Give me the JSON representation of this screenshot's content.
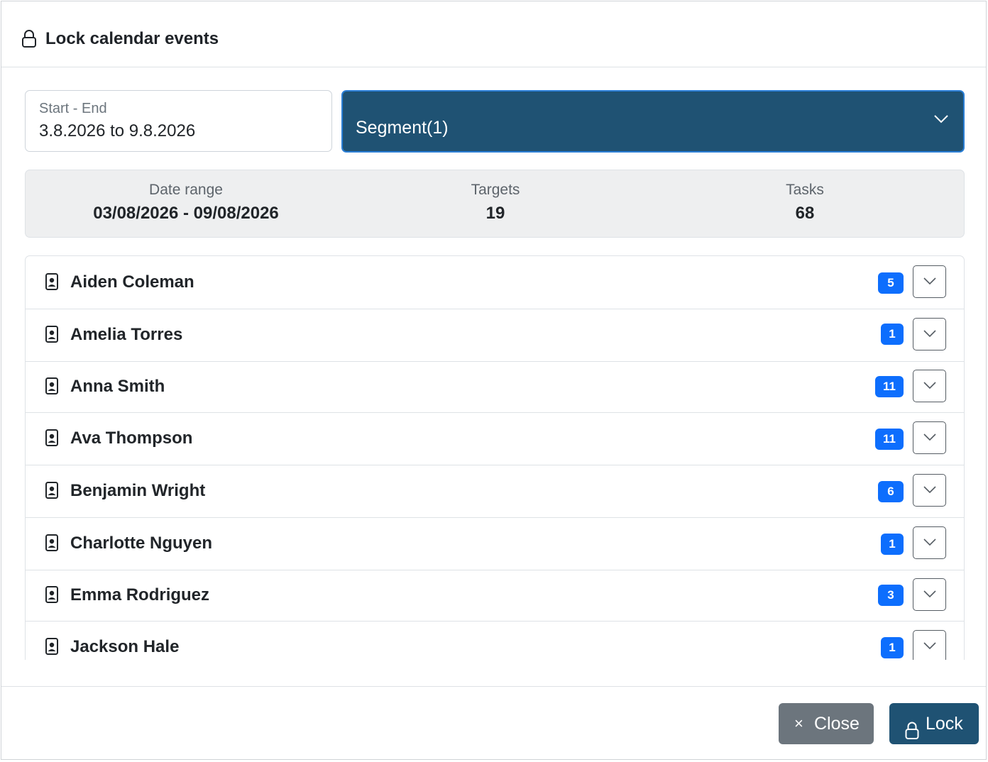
{
  "dialog": {
    "title": "Lock calendar events",
    "title_icon": "lock-icon"
  },
  "date_field": {
    "label": "Start - End",
    "value": "3.8.2026 to 9.8.2026"
  },
  "segment_select": {
    "value": "Segment(1)",
    "icon": "chevron-down-icon"
  },
  "summary": {
    "date_range": {
      "label": "Date range",
      "value": "03/08/2026 - 09/08/2026"
    },
    "targets": {
      "label": "Targets",
      "value": "19"
    },
    "tasks": {
      "label": "Tasks",
      "value": "68"
    }
  },
  "people": [
    {
      "name": "Aiden Coleman",
      "count": "5"
    },
    {
      "name": "Amelia Torres",
      "count": "1"
    },
    {
      "name": "Anna Smith",
      "count": "11"
    },
    {
      "name": "Ava Thompson",
      "count": "11"
    },
    {
      "name": "Benjamin Wright",
      "count": "6"
    },
    {
      "name": "Charlotte Nguyen",
      "count": "1"
    },
    {
      "name": "Emma Rodriguez",
      "count": "3"
    },
    {
      "name": "Jackson Hale",
      "count": "1"
    }
  ],
  "footer": {
    "close_label": "Close",
    "close_icon": "close-icon",
    "lock_label": "Lock",
    "lock_icon": "lock-icon"
  },
  "colors": {
    "primary_dark": "#1f5273",
    "badge": "#0d6efd",
    "secondary": "#6c757d"
  }
}
